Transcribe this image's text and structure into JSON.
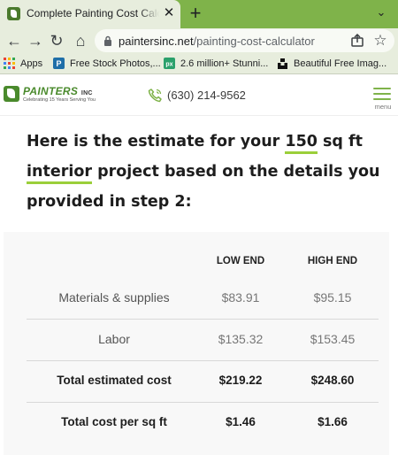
{
  "browser": {
    "tab_title": "Complete Painting Cost Calculator",
    "url_host": "paintersinc.net",
    "url_path": "/painting-cost-calculator",
    "bookmarks": [
      {
        "label": "Apps",
        "icon": "apps-grid-icon"
      },
      {
        "label": "Free Stock Photos,...",
        "icon": "pexels-icon"
      },
      {
        "label": "2.6 million+ Stunni...",
        "icon": "pixabay-icon"
      },
      {
        "label": "Beautiful Free Imag...",
        "icon": "unsplash-icon"
      }
    ]
  },
  "site": {
    "logo_text": "PAINTERS",
    "logo_inc": "INC",
    "logo_tagline": "Celebrating 15 Years Serving You",
    "phone": "(630) 214-9562",
    "menu_label": "menu",
    "accent_color": "#7fb34a"
  },
  "heading": {
    "part1": "Here is the estimate for your ",
    "sqft": "150",
    "part2": " sq ft ",
    "project_type": "interior",
    "part3": " project based on the details you provided in step 2:"
  },
  "table": {
    "columns": [
      "LOW END",
      "HIGH END"
    ],
    "rows": [
      {
        "label": "Materials & supplies",
        "low": "$83.91",
        "high": "$95.15"
      },
      {
        "label": "Labor",
        "low": "$135.32",
        "high": "$153.45"
      },
      {
        "label": "Total estimated cost",
        "low": "$219.22",
        "high": "$248.60"
      },
      {
        "label": "Total cost per sq ft",
        "low": "$1.46",
        "high": "$1.66"
      }
    ]
  }
}
